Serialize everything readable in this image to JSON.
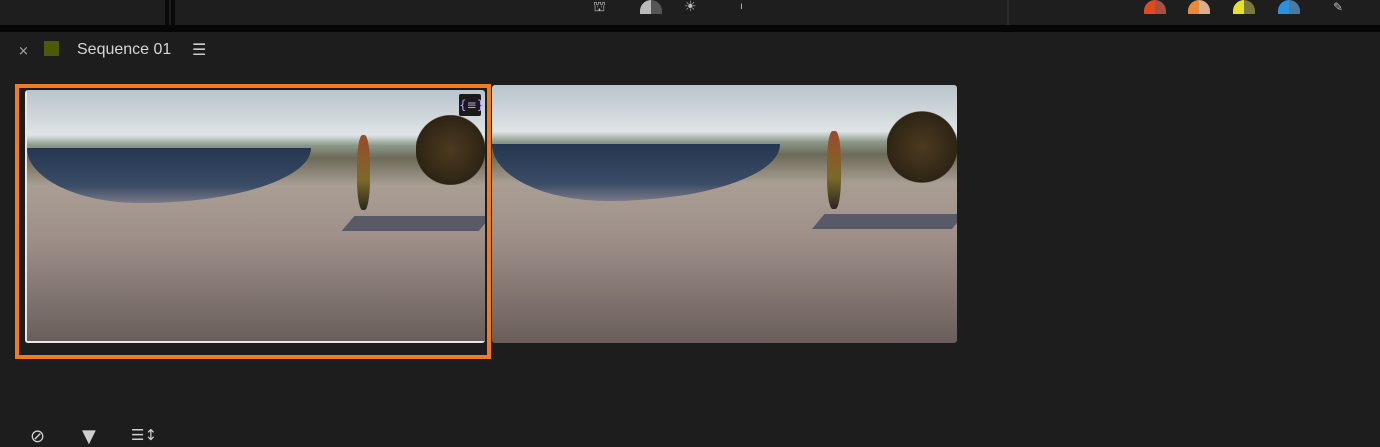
{
  "panel": {
    "title": "Sequence 01",
    "close": "×",
    "menu": "☰",
    "label_color": "#4c5a08"
  },
  "toolbar_icons": [
    "grid-dome-icon",
    "half-dome-icon",
    "sun-icon",
    "tick-icon"
  ],
  "label_colors": [
    [
      "#e04a1e",
      "#a85040"
    ],
    [
      "#e88a3a",
      "#d8ad90"
    ],
    [
      "#e6e22a",
      "#7a7a3a"
    ],
    [
      "#2a90e0",
      "#4a7aa0"
    ]
  ],
  "clips": [
    {
      "selected": true,
      "badge": "{≡}"
    },
    {
      "selected": false
    }
  ],
  "bottom_icons": {
    "hide": "⊘",
    "filter": "▼",
    "sort": "☰↕"
  }
}
